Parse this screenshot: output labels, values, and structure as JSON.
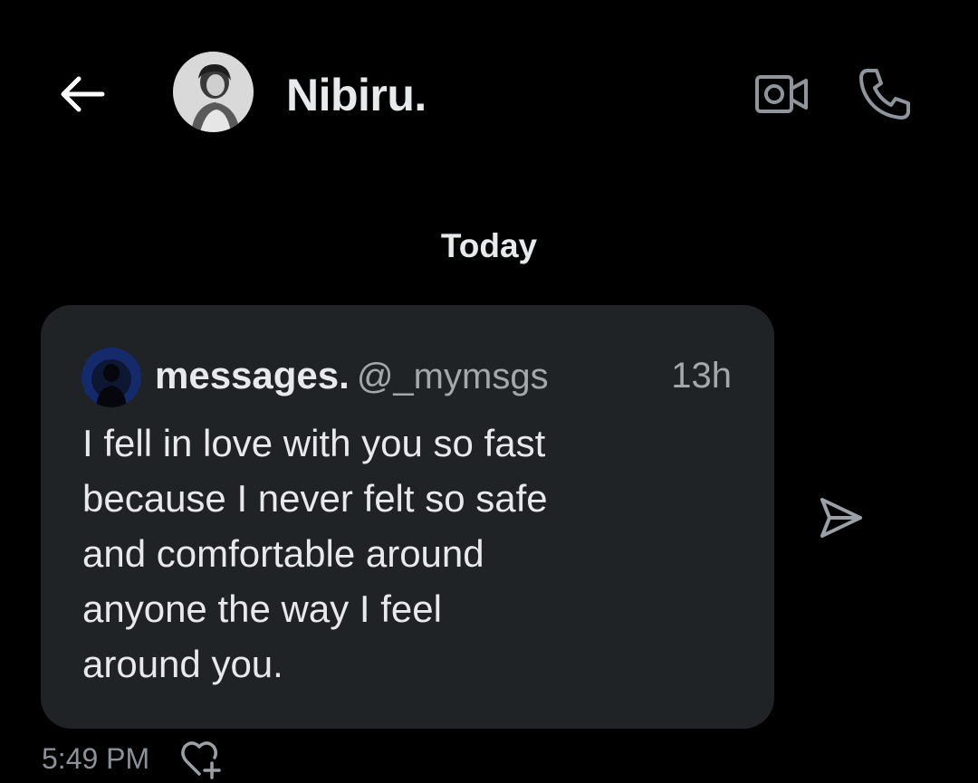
{
  "header": {
    "contact_name": "Nibiru.",
    "back_icon": "arrow-left-icon",
    "video_icon": "video-camera-icon",
    "phone_icon": "phone-icon"
  },
  "conversation": {
    "date_separator": "Today",
    "messages": [
      {
        "type": "shared_post",
        "post": {
          "display_name": "messages.",
          "handle": "@_mymsgs",
          "age": "13h",
          "text": "I fell in love with you so fast\nbecause I never felt so safe\nand comfortable around\nanyone the way I feel\naround you."
        },
        "time": "5:49 PM",
        "share_icon": "send-arrow-icon",
        "reaction_icon": "heart-plus-icon"
      }
    ]
  },
  "colors": {
    "background": "#000000",
    "card_background": "#1f2326",
    "primary_text": "#e7e9ea",
    "secondary_text": "#a3a8ad",
    "icon_color": "#e7e9ea",
    "muted_icon_color": "#9aa0a6"
  }
}
